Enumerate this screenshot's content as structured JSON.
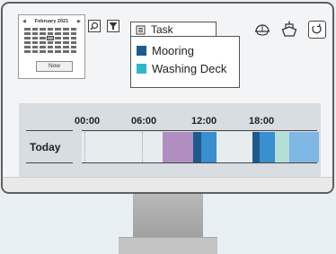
{
  "datepicker": {
    "month_label": "February 2021",
    "now_label": "Now"
  },
  "filter": {
    "placeholder": "Task",
    "options": [
      {
        "label": "Mooring",
        "color": "#1e5a8c"
      },
      {
        "label": "Washing Deck",
        "color": "#2fb6c8"
      }
    ]
  },
  "toolbar_icons": [
    "search-icon",
    "filter-icon",
    "list-icon",
    "helmet-icon",
    "ship-icon",
    "refresh-icon"
  ],
  "timeline": {
    "row_label": "Today",
    "ticks": [
      "00:00",
      "06:00",
      "12:00",
      "18:00"
    ]
  },
  "colors": {
    "purple": "#b08ec2",
    "navy": "#1e5a8c",
    "blue": "#3a8fd0",
    "light_blue": "#7fb7e5",
    "mint": "#b4dfd6"
  }
}
